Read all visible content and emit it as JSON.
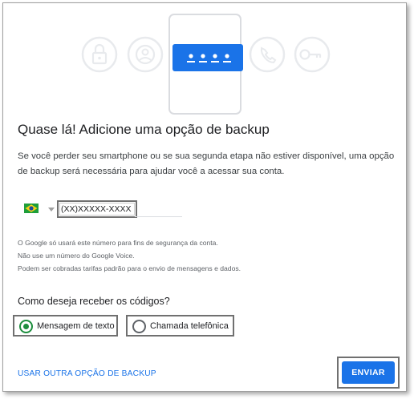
{
  "colors": {
    "primary": "#1a73e8",
    "radio_selected": "#1e8e3e",
    "icon_ring": "#e8eaed",
    "phone_body": "#dadce0"
  },
  "hero": {
    "icons": [
      "lock-icon",
      "person-icon",
      "password-dots-icon",
      "phone-call-icon",
      "key-icon"
    ],
    "password_mask": "• • • •"
  },
  "title": "Quase lá! Adicione uma opção de backup",
  "description": "Se você perder seu smartphone ou se sua segunda etapa não estiver disponível, uma opção de backup será necessária para ajudar você a acessar sua conta.",
  "phone": {
    "country_flag": "brazil-flag",
    "placeholder": "(XX)XXXXX-XXXX"
  },
  "notes": [
    "O Google só usará este número para fins de segurança da conta.",
    "Não use um número do Google Voice.",
    "Podem ser cobradas tarifas padrão para o envio de mensagens e dados."
  ],
  "question": "Como deseja receber os códigos?",
  "options": [
    {
      "label": "Mensagem de texto",
      "selected": true
    },
    {
      "label": "Chamada telefônica",
      "selected": false
    }
  ],
  "footer": {
    "alt_link": "USAR OUTRA OPÇÃO DE BACKUP",
    "submit": "ENVIAR"
  }
}
